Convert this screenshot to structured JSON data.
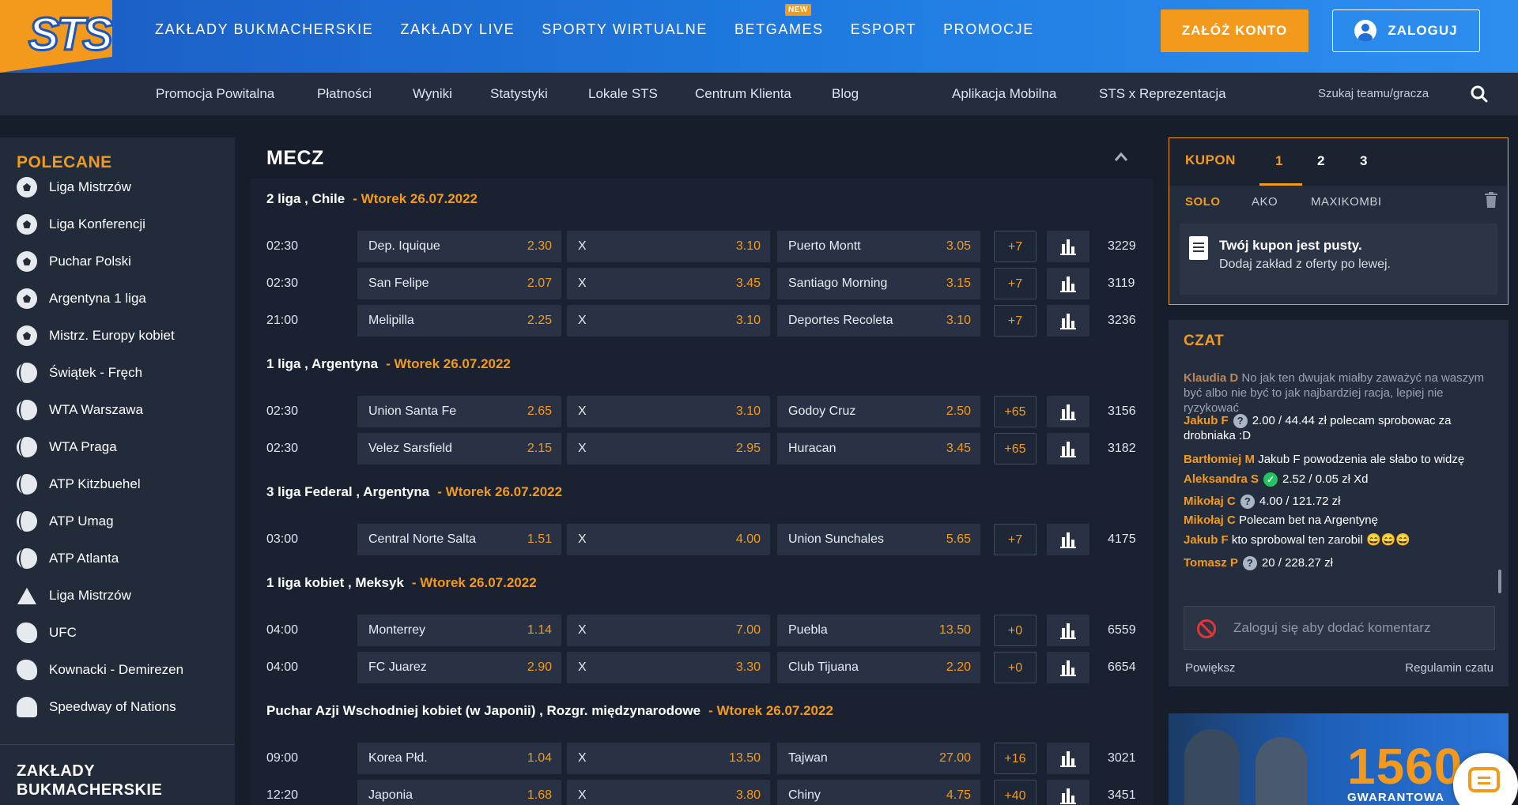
{
  "brand": {
    "logo": "STS",
    "accent": "#f39a1c",
    "header_blue": "#1f7be0"
  },
  "mainnav": [
    {
      "label": "ZAKŁADY BUKMACHERSKIE"
    },
    {
      "label": "ZAKŁADY LIVE"
    },
    {
      "label": "SPORTY WIRTUALNE"
    },
    {
      "label": "BETGAMES",
      "badge": "NEW"
    },
    {
      "label": "ESPORT"
    },
    {
      "label": "PROMOCJE"
    }
  ],
  "auth": {
    "register": "ZAŁÓŻ KONTO",
    "login": "ZALOGUJ"
  },
  "subnav": {
    "items": [
      "Promocja Powitalna",
      "Płatności",
      "Wyniki",
      "Statystyki",
      "Lokale STS",
      "Centrum Klienta",
      "Blog",
      "Aplikacja Mobilna",
      "STS x Reprezentacja"
    ],
    "search_placeholder": "Szukaj teamu/gracza"
  },
  "sidebar": {
    "title": "POLECANE",
    "items": [
      {
        "label": "Liga Mistrzów",
        "icon": "soccer-ball-icon"
      },
      {
        "label": "Liga Konferencji",
        "icon": "soccer-ball-icon"
      },
      {
        "label": "Puchar Polski",
        "icon": "soccer-ball-icon"
      },
      {
        "label": "Argentyna 1 liga",
        "icon": "soccer-ball-icon"
      },
      {
        "label": "Mistrz. Europy kobiet",
        "icon": "soccer-ball-icon"
      },
      {
        "label": "Świątek - Fręch",
        "icon": "tennis-ball-icon"
      },
      {
        "label": "WTA Warszawa",
        "icon": "tennis-ball-icon"
      },
      {
        "label": "WTA Praga",
        "icon": "tennis-ball-icon"
      },
      {
        "label": "ATP Kitzbuehel",
        "icon": "tennis-ball-icon"
      },
      {
        "label": "ATP Umag",
        "icon": "tennis-ball-icon"
      },
      {
        "label": "ATP Atlanta",
        "icon": "tennis-ball-icon"
      },
      {
        "label": "Liga Mistrzów",
        "icon": "snooker-triangle-icon"
      },
      {
        "label": "UFC",
        "icon": "boxing-glove-icon"
      },
      {
        "label": "Kownacki - Demirezen",
        "icon": "boxing-glove-icon"
      },
      {
        "label": "Speedway of Nations",
        "icon": "helmet-icon"
      }
    ],
    "bottom_title": "ZAKŁADY BUKMACHERSKIE"
  },
  "section": {
    "title": "MECZ"
  },
  "leagues": [
    {
      "name": "2 liga , Chile",
      "date": "- Wtorek 26.07.2022",
      "matches": [
        {
          "time": "02:30",
          "home": "Dep. Iquique",
          "home_odd": "2.30",
          "draw": "X",
          "draw_odd": "3.10",
          "away": "Puerto Montt",
          "away_odd": "3.05",
          "more": "+7",
          "id": "3229"
        },
        {
          "time": "02:30",
          "home": "San Felipe",
          "home_odd": "2.07",
          "draw": "X",
          "draw_odd": "3.45",
          "away": "Santiago Morning",
          "away_odd": "3.15",
          "more": "+7",
          "id": "3119"
        },
        {
          "time": "21:00",
          "home": "Melipilla",
          "home_odd": "2.25",
          "draw": "X",
          "draw_odd": "3.10",
          "away": "Deportes Recoleta",
          "away_odd": "3.10",
          "more": "+7",
          "id": "3236"
        }
      ]
    },
    {
      "name": "1 liga , Argentyna",
      "date": "- Wtorek 26.07.2022",
      "matches": [
        {
          "time": "02:30",
          "home": "Union Santa Fe",
          "home_odd": "2.65",
          "draw": "X",
          "draw_odd": "3.10",
          "away": "Godoy Cruz",
          "away_odd": "2.50",
          "more": "+65",
          "id": "3156"
        },
        {
          "time": "02:30",
          "home": "Velez Sarsfield",
          "home_odd": "2.15",
          "draw": "X",
          "draw_odd": "2.95",
          "away": "Huracan",
          "away_odd": "3.45",
          "more": "+65",
          "id": "3182"
        }
      ]
    },
    {
      "name": "3 liga Federal , Argentyna",
      "date": "- Wtorek 26.07.2022",
      "matches": [
        {
          "time": "03:00",
          "home": "Central Norte Salta",
          "home_odd": "1.51",
          "draw": "X",
          "draw_odd": "4.00",
          "away": "Union Sunchales",
          "away_odd": "5.65",
          "more": "+7",
          "id": "4175"
        }
      ]
    },
    {
      "name": "1 liga kobiet , Meksyk",
      "date": "- Wtorek 26.07.2022",
      "matches": [
        {
          "time": "04:00",
          "home": "Monterrey",
          "home_odd": "1.14",
          "draw": "X",
          "draw_odd": "7.00",
          "away": "Puebla",
          "away_odd": "13.50",
          "more": "+0",
          "id": "6559"
        },
        {
          "time": "04:00",
          "home": "FC Juarez",
          "home_odd": "2.90",
          "draw": "X",
          "draw_odd": "3.30",
          "away": "Club Tijuana",
          "away_odd": "2.20",
          "more": "+0",
          "id": "6654"
        }
      ]
    },
    {
      "name": "Puchar Azji Wschodniej kobiet (w Japonii) , Rozgr. międzynarodowe",
      "date": "- Wtorek 26.07.2022",
      "matches": [
        {
          "time": "09:00",
          "home": "Korea Płd.",
          "home_odd": "1.04",
          "draw": "X",
          "draw_odd": "13.50",
          "away": "Tajwan",
          "away_odd": "27.00",
          "more": "+16",
          "id": "3021"
        },
        {
          "time": "12:20",
          "home": "Japonia",
          "home_odd": "1.68",
          "draw": "X",
          "draw_odd": "3.80",
          "away": "Chiny",
          "away_odd": "4.75",
          "more": "+40",
          "id": "3451"
        }
      ]
    }
  ],
  "kupon": {
    "title": "KUPON",
    "tabs": [
      "1",
      "2",
      "3"
    ],
    "bet_types": [
      "SOLO",
      "AKO",
      "MAXIKOMBI"
    ],
    "empty_title": "Twój kupon jest pusty.",
    "empty_sub": "Dodaj zakład z oferty po lewej."
  },
  "czat": {
    "title": "CZAT",
    "messages": [
      {
        "user": "Klaudia D",
        "text": "No jak ten dwujak miałby zaważyć na waszym być albo nie być to jak najbardziej racja, lepiej nie ryzykować",
        "faded": true
      },
      {
        "user": "Jakub F",
        "badge": "?",
        "text": "2.00 / 44.44 zł polecam sprobowac za drobniaka :D"
      },
      {
        "user": "Bartłomiej M",
        "text": "Jakub F powodzenia ale słabo to widzę"
      },
      {
        "user": "Aleksandra S",
        "badge": "✓",
        "text": "2.52 / 0.05 zł Xd"
      },
      {
        "user": "Mikołaj C",
        "badge": "?",
        "text": "4.00 / 121.72 zł"
      },
      {
        "user": "Mikołaj C",
        "text": "Polecam bet na Argentynę"
      },
      {
        "user": "Jakub F",
        "text": "kto sprobowal ten zarobil 😄😄😄"
      },
      {
        "user": "Tomasz P",
        "badge": "?",
        "text": "20 / 228.27 zł"
      }
    ],
    "input_placeholder": "Zaloguj się aby dodać komentarz",
    "enlarge": "Powiększ",
    "rules": "Regulamin czatu"
  },
  "banner": {
    "number": "1560",
    "subtitle": "GWARANTOWA"
  }
}
